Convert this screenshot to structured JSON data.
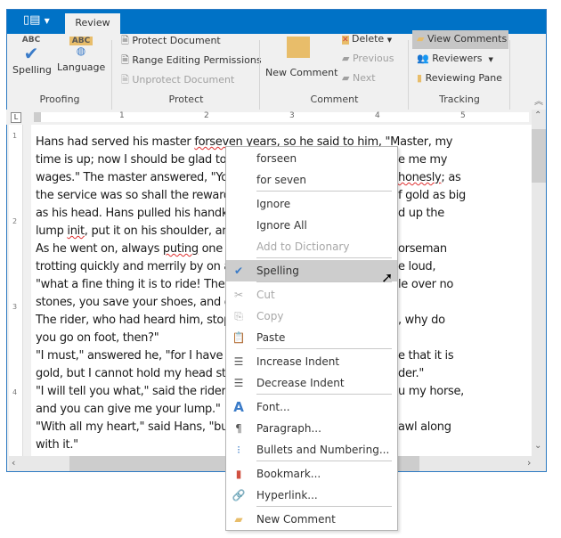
{
  "ribbon": {
    "tab": "Review",
    "proofing": {
      "spelling": "Spelling",
      "language": "Language",
      "group": "Proofing"
    },
    "protect": {
      "protect_document": "Protect Document",
      "range_editing": "Range Editing Permissions",
      "unprotect_document": "Unprotect Document",
      "group": "Protect"
    },
    "comment": {
      "new_comment": "New Comment",
      "delete": "Delete",
      "previous": "Previous",
      "next": "Next",
      "group": "Comment"
    },
    "tracking": {
      "view_comments": "View Comments",
      "reviewers": "Reviewers",
      "reviewing_pane": "Reviewing Pane",
      "group": "Tracking"
    }
  },
  "ruler": {
    "ticks": [
      "1",
      "2",
      "3",
      "4",
      "5"
    ]
  },
  "vruler": {
    "ticks": [
      "1",
      "2",
      "3",
      "4"
    ]
  },
  "document": {
    "lines": [
      {
        "l": "Hans had served his master ",
        "sq": "forseven",
        "l2": " years, so he said to him, \"Master, my",
        "r": ""
      },
      {
        "l": "time is up; now I should be glad to g",
        "r": "e me my"
      },
      {
        "l": "wages.\" The master answered, \"You",
        "r": "honesly; as"
      },
      {
        "l": "the service was so shall the reward",
        "r": "f gold as big"
      },
      {
        "l": "as his head. Hans pulled his handke",
        "r": "d up the"
      },
      {
        "l": "lump ",
        "sq": "init",
        "l2": ", put it on his shoulder, and",
        "r": ""
      },
      {
        "l": "As he went on, always ",
        "sq": "puting",
        "l2": " one f",
        "r": "orseman"
      },
      {
        "l": "trotting quickly and merrily by on a",
        "r": "e loud,"
      },
      {
        "l": "\"what a fine thing it is to ride! There",
        "r": "le over no"
      },
      {
        "l": "stones, you save your shoes, and ge",
        "r": ""
      },
      {
        "l": "The rider, who had heard him, stop",
        "r": ", why do"
      },
      {
        "l": "you go on foot, then?\"",
        "r": ""
      },
      {
        "l": "\"I must,\" answered he, \"for I have t",
        "r": "e that it is"
      },
      {
        "l": "gold, but I cannot hold my head stra",
        "r": "der.\""
      },
      {
        "l": "\"I will tell you what,\" said the rider,",
        "r": "u my horse,"
      },
      {
        "l": "and you can give me your lump.\"",
        "r": ""
      },
      {
        "l": "\"With all my heart,\" said Hans, \"but",
        "r": "awl along"
      },
      {
        "l": "with it.\"",
        "r": ""
      }
    ]
  },
  "context_menu": {
    "items": [
      {
        "label": "forseen",
        "icon": ""
      },
      {
        "label": "for seven",
        "icon": ""
      },
      {
        "label": "Ignore",
        "icon": ""
      },
      {
        "label": "Ignore All",
        "icon": ""
      },
      {
        "label": "Add to Dictionary",
        "icon": "",
        "disabled": true
      },
      {
        "label": "Spelling",
        "icon": "spelling-icon",
        "highlighted": true
      },
      {
        "label": "Cut",
        "icon": "scissors-icon",
        "disabled": true
      },
      {
        "label": "Copy",
        "icon": "copy-icon",
        "disabled": true
      },
      {
        "label": "Paste",
        "icon": "paste-icon"
      },
      {
        "label": "Increase Indent",
        "icon": "increase-indent-icon"
      },
      {
        "label": "Decrease Indent",
        "icon": "decrease-indent-icon"
      },
      {
        "label": "Font...",
        "icon": "font-icon"
      },
      {
        "label": "Paragraph...",
        "icon": "paragraph-icon"
      },
      {
        "label": "Bullets and Numbering...",
        "icon": "bullets-icon"
      },
      {
        "label": "Bookmark...",
        "icon": "bookmark-icon"
      },
      {
        "label": "Hyperlink...",
        "icon": "hyperlink-icon"
      },
      {
        "label": "New Comment",
        "icon": "new-comment-icon"
      }
    ]
  },
  "colors": {
    "title_bar": "#0072c6",
    "accent_blue": "#3a7bc8",
    "comment_yellow": "#e8bd6a"
  }
}
